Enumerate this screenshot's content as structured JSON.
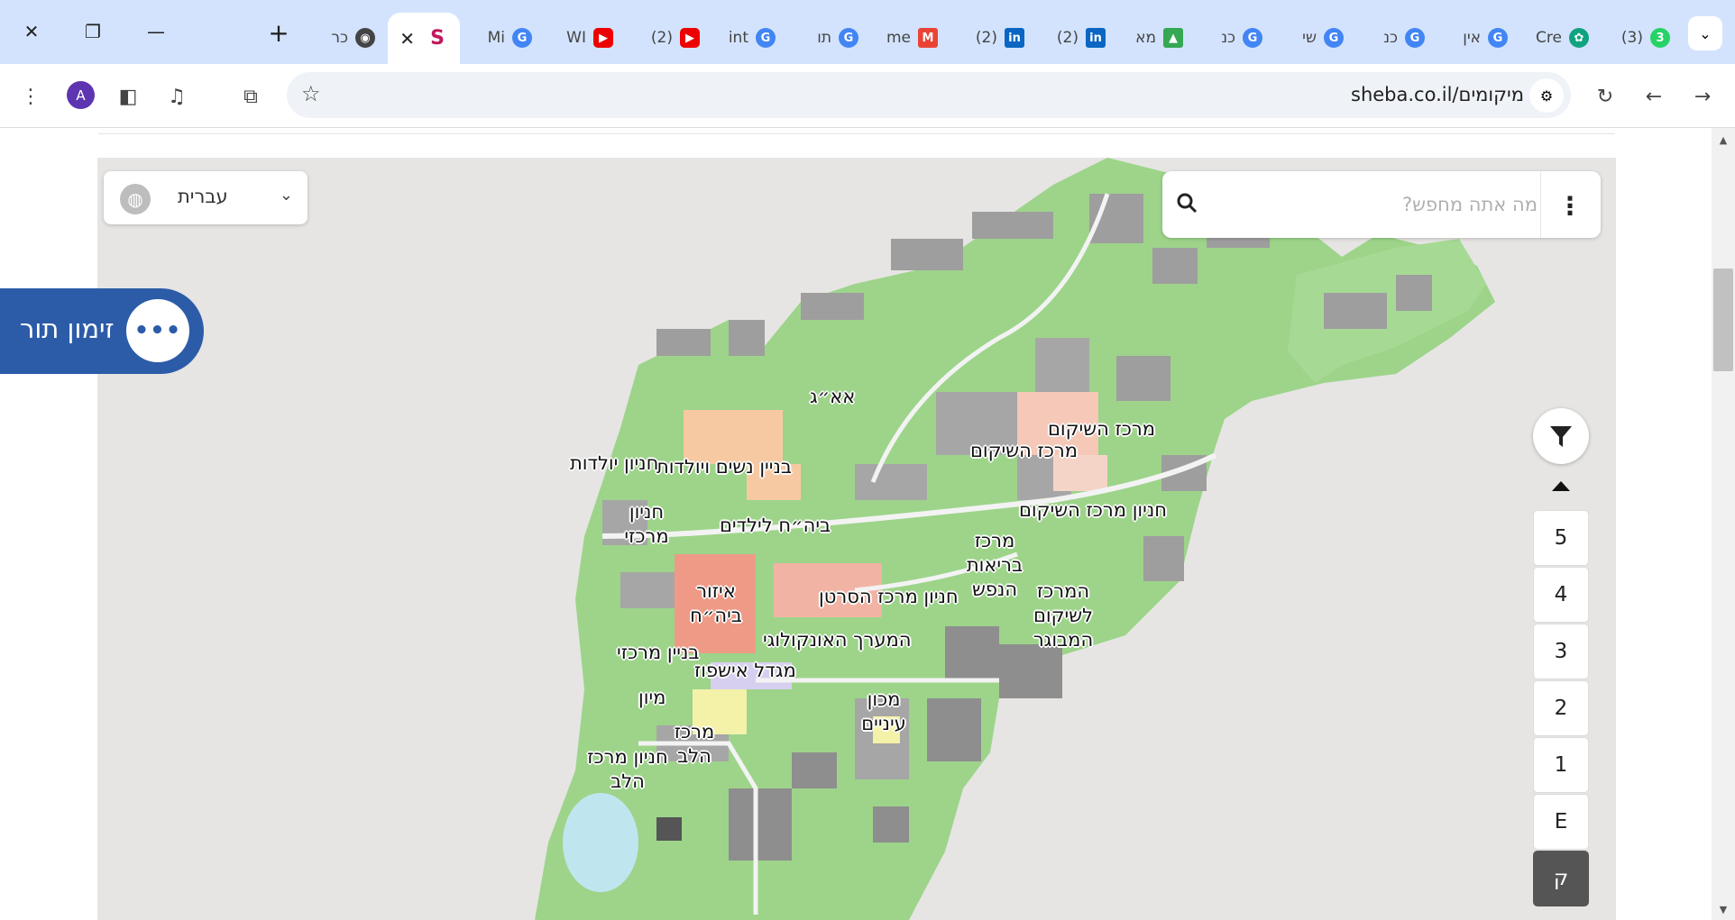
{
  "browser": {
    "tabs": [
      {
        "label": "כר",
        "favicon": "chrome-icon"
      },
      {
        "label": "",
        "favicon": "sheba-s-icon",
        "active": true
      },
      {
        "label": "Mi",
        "favicon": "google-icon"
      },
      {
        "label": "WI",
        "favicon": "youtube-icon"
      },
      {
        "label": "(2)",
        "favicon": "youtube-icon"
      },
      {
        "label": "int",
        "favicon": "google-icon"
      },
      {
        "label": "תו",
        "favicon": "google-icon"
      },
      {
        "label": "me",
        "favicon": "gmail-icon"
      },
      {
        "label": "(2)",
        "favicon": "linkedin-icon"
      },
      {
        "label": "(2)",
        "favicon": "linkedin-icon"
      },
      {
        "label": "מא",
        "favicon": "drive-icon"
      },
      {
        "label": "כנ",
        "favicon": "google-icon"
      },
      {
        "label": "שי",
        "favicon": "google-icon"
      },
      {
        "label": "כנ",
        "favicon": "google-icon"
      },
      {
        "label": "אין",
        "favicon": "google-icon"
      },
      {
        "label": "Cre",
        "favicon": "chatgpt-icon"
      },
      {
        "label": "(3)",
        "favicon": "whatsapp-icon"
      }
    ],
    "url": "sheba.co.il/מיקומים",
    "avatar_letter": "A",
    "active_tab_close": "✕"
  },
  "map": {
    "language": "עברית",
    "search_placeholder": "מה אתה מחפש?",
    "book_appointment": "זימון תור",
    "floors": [
      "5",
      "4",
      "3",
      "2",
      "1",
      "E",
      "ק"
    ],
    "active_floor": "ק",
    "labels": [
      "אא״ג",
      "מרכז השיקום",
      "מרכז השיקום",
      "בניין נשים ויולדות",
      "חניון יולדות",
      "חניון מרכז השיקום",
      "חניון מרכזי",
      "ביה״ח לילדים",
      "מרכז בריאות הנפש",
      "איזור ביה״ח",
      "חניון מרכז הסרטן",
      "המרכז לשיקום המבוגר",
      "המערך האונקולוגי",
      "בניין מרכזי",
      "מגדל אישפוז",
      "מיון",
      "מכון עיניים",
      "מרכז הלב",
      "חניון מרכז הלב"
    ]
  },
  "colors": {
    "tabstrip_bg": "#d3e3fd",
    "campus_green": "#9dd48a",
    "lake": "#bfe6ef",
    "booking_blue": "#2c5ca8"
  }
}
